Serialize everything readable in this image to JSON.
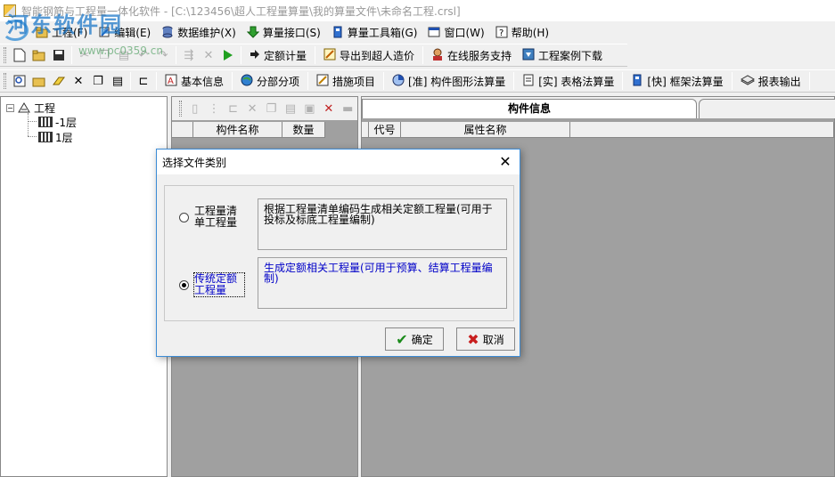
{
  "window": {
    "title": "智能钢筋与工程量一体化软件 - [C:\\123456\\超人工程量算量\\我的算量文件\\未命名工程.crsl]"
  },
  "watermark": {
    "text": "河东软件园",
    "url": "www.pc0359.cn"
  },
  "menu": [
    {
      "label": "工程(F)",
      "icon": "folder-icon"
    },
    {
      "label": "编辑(E)",
      "icon": "edit-icon"
    },
    {
      "label": "数据维护(X)",
      "icon": "database-icon"
    },
    {
      "label": "算量接口(S)",
      "icon": "arrow-down-icon"
    },
    {
      "label": "算量工具箱(G)",
      "icon": "toolbox-icon"
    },
    {
      "label": "窗口(W)",
      "icon": "window-icon"
    },
    {
      "label": "帮助(H)",
      "icon": "help-icon"
    }
  ],
  "toolbar1": {
    "text_buttons": [
      {
        "label": "定额计量"
      },
      {
        "label": "导出到超人造价"
      },
      {
        "label": "在线服务支持"
      },
      {
        "label": "工程案例下载"
      }
    ]
  },
  "toolbar2": {
    "tabs": [
      {
        "label": "基本信息"
      },
      {
        "label": "分部分项"
      },
      {
        "label": "措施项目"
      },
      {
        "label": "[准] 构件图形法算量"
      },
      {
        "label": "[实] 表格法算量"
      },
      {
        "label": "[快] 框架法算量"
      },
      {
        "label": "报表输出"
      }
    ]
  },
  "tree": {
    "root": "工程",
    "children": [
      "-1层",
      "1层"
    ]
  },
  "component_grid": {
    "columns": [
      "构件名称",
      "数量"
    ]
  },
  "info_panel": {
    "tab_title": "构件信息",
    "columns": [
      "代号",
      "属性名称"
    ]
  },
  "dialog": {
    "title": "选择文件类别",
    "options": [
      {
        "label": "工程量清单工程量",
        "description": "根据工程量清单编码生成相关定额工程量(可用于投标及标底工程量编制)",
        "selected": false
      },
      {
        "label": "传统定额工程量",
        "description": "生成定额相关工程量(可用于预算、结算工程量编制)",
        "selected": true
      }
    ],
    "ok_label": "确定",
    "cancel_label": "取消"
  }
}
